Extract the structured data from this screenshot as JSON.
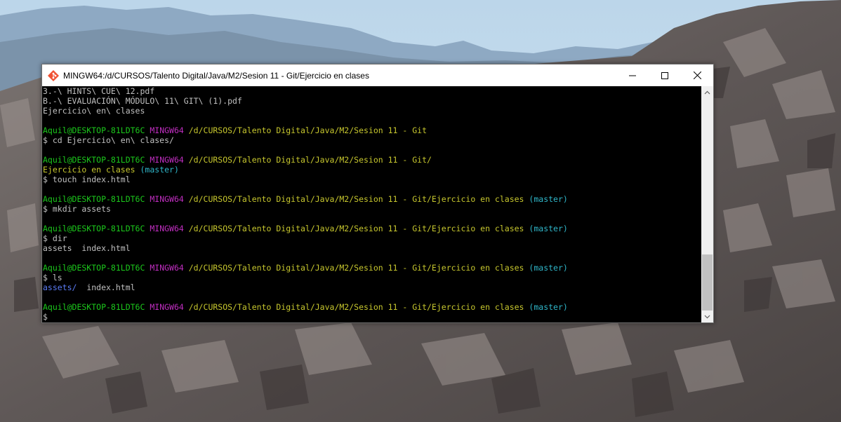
{
  "window": {
    "title": "MINGW64:/d/CURSOS/Talento Digital/Java/M2/Sesion 11 - Git/Ejercicio en clases",
    "app_icon": "git-bash-icon",
    "controls": [
      "minimize-icon",
      "maximize-icon",
      "close-icon"
    ]
  },
  "terminal": {
    "lines": [
      {
        "segments": [
          {
            "text": "3.-\\ HINTS\\ CUE\\ 12.pdf",
            "color": "default"
          }
        ]
      },
      {
        "segments": [
          {
            "text": "B.-\\ EVALUACIÓN\\ MÓDULO\\ 11\\ GIT\\ (1).pdf",
            "color": "default"
          }
        ]
      },
      {
        "segments": [
          {
            "text": "Ejercicio\\ en\\ clases",
            "color": "default"
          }
        ]
      },
      {
        "segments": []
      },
      {
        "segments": [
          {
            "text": "Aquil@DESKTOP-81LDT6C",
            "color": "green"
          },
          {
            "text": " ",
            "color": "default"
          },
          {
            "text": "MINGW64",
            "color": "magenta"
          },
          {
            "text": " ",
            "color": "default"
          },
          {
            "text": "/d/CURSOS/Talento Digital/Java/M2/Sesion 11 - Git",
            "color": "yellow"
          }
        ]
      },
      {
        "segments": [
          {
            "text": "$ cd Ejercicio\\ en\\ clases/",
            "color": "default"
          }
        ]
      },
      {
        "segments": []
      },
      {
        "segments": [
          {
            "text": "Aquil@DESKTOP-81LDT6C",
            "color": "green"
          },
          {
            "text": " ",
            "color": "default"
          },
          {
            "text": "MINGW64",
            "color": "magenta"
          },
          {
            "text": " ",
            "color": "default"
          },
          {
            "text": "/d/CURSOS/Talento Digital/Java/M2/Sesion 11 - Git/",
            "color": "yellow"
          }
        ]
      },
      {
        "segments": [
          {
            "text": "Ejercicio en clases",
            "color": "yellow"
          },
          {
            "text": " ",
            "color": "default"
          },
          {
            "text": "(master)",
            "color": "cyan"
          }
        ]
      },
      {
        "segments": [
          {
            "text": "$ touch index.html",
            "color": "default"
          }
        ]
      },
      {
        "segments": []
      },
      {
        "segments": [
          {
            "text": "Aquil@DESKTOP-81LDT6C",
            "color": "green"
          },
          {
            "text": " ",
            "color": "default"
          },
          {
            "text": "MINGW64",
            "color": "magenta"
          },
          {
            "text": " ",
            "color": "default"
          },
          {
            "text": "/d/CURSOS/Talento Digital/Java/M2/Sesion 11 - Git/Ejercicio en clases",
            "color": "yellow"
          },
          {
            "text": " ",
            "color": "default"
          },
          {
            "text": "(master)",
            "color": "cyan"
          }
        ]
      },
      {
        "segments": [
          {
            "text": "$ mkdir assets",
            "color": "default"
          }
        ]
      },
      {
        "segments": []
      },
      {
        "segments": [
          {
            "text": "Aquil@DESKTOP-81LDT6C",
            "color": "green"
          },
          {
            "text": " ",
            "color": "default"
          },
          {
            "text": "MINGW64",
            "color": "magenta"
          },
          {
            "text": " ",
            "color": "default"
          },
          {
            "text": "/d/CURSOS/Talento Digital/Java/M2/Sesion 11 - Git/Ejercicio en clases",
            "color": "yellow"
          },
          {
            "text": " ",
            "color": "default"
          },
          {
            "text": "(master)",
            "color": "cyan"
          }
        ]
      },
      {
        "segments": [
          {
            "text": "$ dir",
            "color": "default"
          }
        ]
      },
      {
        "segments": [
          {
            "text": "assets  index.html",
            "color": "default"
          }
        ]
      },
      {
        "segments": []
      },
      {
        "segments": [
          {
            "text": "Aquil@DESKTOP-81LDT6C",
            "color": "green"
          },
          {
            "text": " ",
            "color": "default"
          },
          {
            "text": "MINGW64",
            "color": "magenta"
          },
          {
            "text": " ",
            "color": "default"
          },
          {
            "text": "/d/CURSOS/Talento Digital/Java/M2/Sesion 11 - Git/Ejercicio en clases",
            "color": "yellow"
          },
          {
            "text": " ",
            "color": "default"
          },
          {
            "text": "(master)",
            "color": "cyan"
          }
        ]
      },
      {
        "segments": [
          {
            "text": "$ ls",
            "color": "default"
          }
        ]
      },
      {
        "segments": [
          {
            "text": "assets/",
            "color": "blue"
          },
          {
            "text": "  index.html",
            "color": "default"
          }
        ]
      },
      {
        "segments": []
      },
      {
        "segments": [
          {
            "text": "Aquil@DESKTOP-81LDT6C",
            "color": "green"
          },
          {
            "text": " ",
            "color": "default"
          },
          {
            "text": "MINGW64",
            "color": "magenta"
          },
          {
            "text": " ",
            "color": "default"
          },
          {
            "text": "/d/CURSOS/Talento Digital/Java/M2/Sesion 11 - Git/Ejercicio en clases",
            "color": "yellow"
          },
          {
            "text": " ",
            "color": "default"
          },
          {
            "text": "(master)",
            "color": "cyan"
          }
        ]
      },
      {
        "segments": [
          {
            "text": "$",
            "color": "default"
          }
        ]
      }
    ]
  },
  "colors": {
    "terminal_bg": "#000000",
    "default_text": "#c0c0c0",
    "prompt_user": "#1cc91c",
    "prompt_shell": "#c02ec0",
    "prompt_path": "#c7c72e",
    "git_branch": "#2fb6c9",
    "directory": "#5b7cf6"
  }
}
